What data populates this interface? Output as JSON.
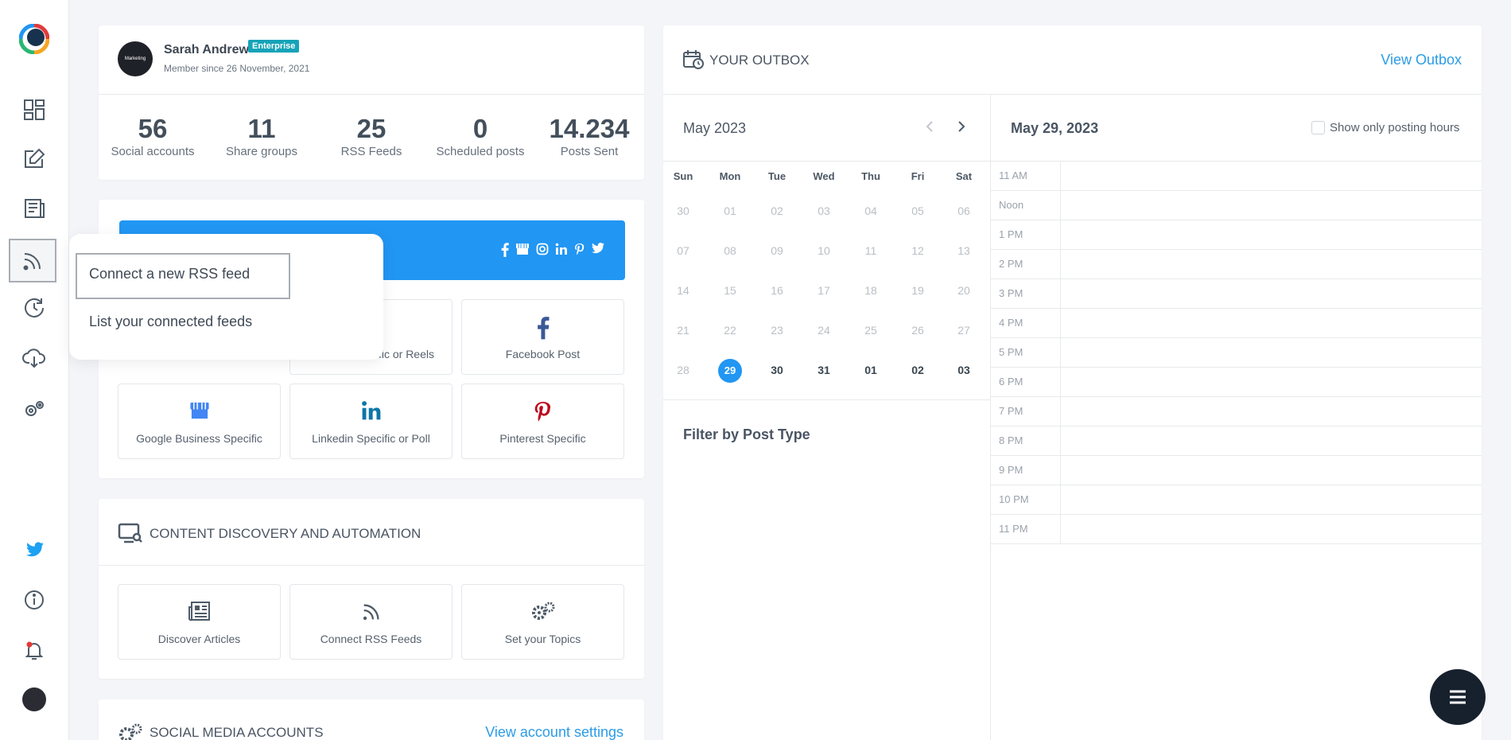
{
  "profile": {
    "name": "Sarah Andrew",
    "badge": "Enterprise",
    "member_since": "Member since 26 November, 2021",
    "avatar_text": "Marketing"
  },
  "stats": [
    {
      "value": "56",
      "label": "Social accounts"
    },
    {
      "value": "11",
      "label": "Share groups"
    },
    {
      "value": "25",
      "label": "RSS Feeds"
    },
    {
      "value": "0",
      "label": "Scheduled posts"
    },
    {
      "value": "14.234",
      "label": "Posts Sent"
    }
  ],
  "post_types": [
    {
      "label": "...cific or Reels",
      "icon": "instagram-icon"
    },
    {
      "label": "Facebook Post",
      "icon": "facebook-icon"
    },
    {
      "label": "Google Business Specific",
      "icon": "google-business-icon"
    },
    {
      "label": "Linkedin Specific or Poll",
      "icon": "linkedin-icon"
    },
    {
      "label": "Pinterest Specific",
      "icon": "pinterest-icon"
    }
  ],
  "content_discovery": {
    "title": "CONTENT DISCOVERY AND AUTOMATION",
    "tiles": [
      {
        "label": "Discover Articles",
        "icon": "newspaper-icon"
      },
      {
        "label": "Connect RSS Feeds",
        "icon": "rss-icon"
      },
      {
        "label": "Set your Topics",
        "icon": "gears-icon"
      }
    ]
  },
  "social_accounts": {
    "title": "SOCIAL MEDIA ACCOUNTS",
    "link": "View account settings"
  },
  "outbox": {
    "title": "YOUR OUTBOX",
    "link": "View Outbox",
    "month_label": "May 2023",
    "selected_date": "May 29, 2023",
    "show_posting_hours_label": "Show only posting hours",
    "filter_title": "Filter by Post Type",
    "weekdays": [
      "Sun",
      "Mon",
      "Tue",
      "Wed",
      "Thu",
      "Fri",
      "Sat"
    ],
    "weeks": [
      [
        "30",
        "01",
        "02",
        "03",
        "04",
        "05",
        "06"
      ],
      [
        "07",
        "08",
        "09",
        "10",
        "11",
        "12",
        "13"
      ],
      [
        "14",
        "15",
        "16",
        "17",
        "18",
        "19",
        "20"
      ],
      [
        "21",
        "22",
        "23",
        "24",
        "25",
        "26",
        "27"
      ],
      [
        "28",
        "29",
        "30",
        "31",
        "01",
        "02",
        "03"
      ]
    ],
    "selected_day": "29",
    "hours": [
      "11 AM",
      "Noon",
      "1 PM",
      "2 PM",
      "3 PM",
      "4 PM",
      "5 PM",
      "6 PM",
      "7 PM",
      "8 PM",
      "9 PM",
      "10 PM",
      "11 PM"
    ]
  },
  "rss_menu": {
    "items": [
      "Connect a new RSS feed",
      "List your connected feeds"
    ]
  },
  "colors": {
    "accent": "#2196f3",
    "link": "#2b9ce6",
    "badge": "#16a3b8",
    "fab": "#17212e"
  }
}
